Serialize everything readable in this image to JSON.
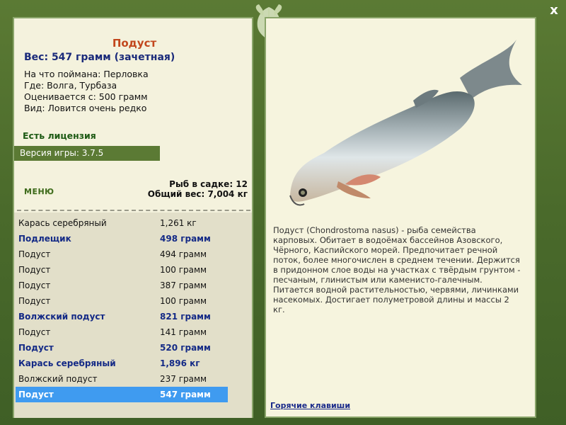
{
  "window": {
    "close_label": "x"
  },
  "fish": {
    "name": "Подуст",
    "weight": "Вес: 547 грамм (зачетная)",
    "bait": "На что поймана: Перловка",
    "location": "Где: Волга, Турбаза",
    "rated_from": "Оценивается с: 500 грамм",
    "rarity": "Вид: Ловится очень редко",
    "description": "Подуст (Chondrostoma nasus) - рыба семейства карповых. Обитает в водоёмах бассейнов Азовского, Чёрного, Каспийского морей. Предпочитает речной поток, более многочислен в среднем течении. Держится в придонном слое воды на участках с твёрдым грунтом - песчаным, глинистым или каменисто-галечным. Питается водной растительностью, червями, личинками насекомых. Достигает полуметровой длины и массы 2 кг."
  },
  "license": "Есть лицензия",
  "version": "Версия игры: 3.7.5",
  "menu_label": "МЕНЮ",
  "stats": {
    "fish_in_keepnet": "Рыб в садке: 12",
    "total_weight": "Общий вес: 7,004 кг"
  },
  "catch": [
    {
      "name": "Карась серебряный",
      "weight": "1,261 кг",
      "style": "normal"
    },
    {
      "name": "Подлещик",
      "weight": "498 грамм",
      "style": "bold"
    },
    {
      "name": "Подуст",
      "weight": "494 грамм",
      "style": "normal"
    },
    {
      "name": "Подуст",
      "weight": "100 грамм",
      "style": "normal"
    },
    {
      "name": "Подуст",
      "weight": "387 грамм",
      "style": "normal"
    },
    {
      "name": "Подуст",
      "weight": "100 грамм",
      "style": "normal"
    },
    {
      "name": "Волжский подуст",
      "weight": "821 грамм",
      "style": "bold"
    },
    {
      "name": "Подуст",
      "weight": "141 грамм",
      "style": "normal"
    },
    {
      "name": "Подуст",
      "weight": "520 грамм",
      "style": "bold"
    },
    {
      "name": "Карась серебряный",
      "weight": "1,896 кг",
      "style": "bold"
    },
    {
      "name": "Волжский подуст",
      "weight": "237 грамм",
      "style": "normal"
    },
    {
      "name": "Подуст",
      "weight": "547 грамм",
      "style": "selected"
    }
  ],
  "hotkeys_label": "Горячие клавиши",
  "colors": {
    "frame": "#4d6a2e",
    "panel": "#f4f2dd",
    "fish_name": "#c2471d",
    "weight": "#1a2a7a",
    "selected_row": "#3f9bf0"
  }
}
